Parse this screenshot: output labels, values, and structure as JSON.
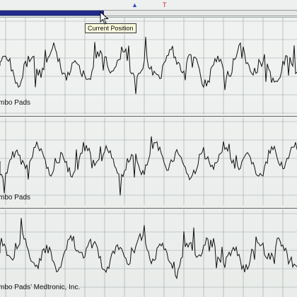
{
  "tooltip": {
    "text": "Current Position"
  },
  "timeline": {
    "progress_percent": 35,
    "marker_blue_icon": "event-marker-icon",
    "marker_red_icon": "event-marker-icon"
  },
  "cursor": {
    "icon": "mouse-pointer-icon"
  },
  "channels": [
    {
      "label": "mbo Pads"
    },
    {
      "label": "mbo Pads"
    },
    {
      "label": "mbo Pads’ Medtronic, Inc."
    }
  ],
  "colors": {
    "grid": "#9aa3a2",
    "trace": "#111111",
    "progress": "#1f2a8a"
  }
}
